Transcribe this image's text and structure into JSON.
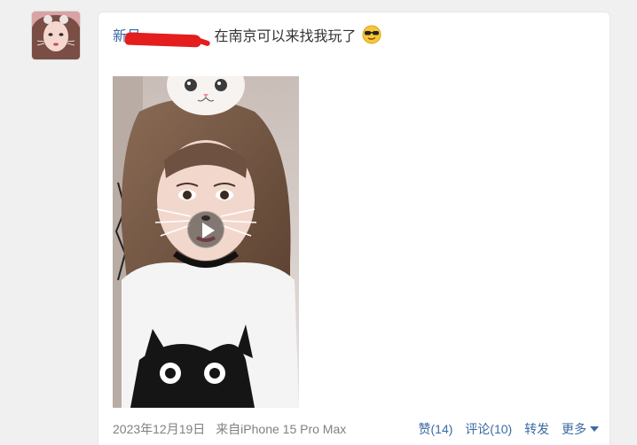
{
  "post": {
    "username": "新号",
    "text": "在南京可以来找我玩了",
    "emoji_icon": "sunglasses-emoji-icon"
  },
  "media": {
    "type": "video",
    "play_icon": "play-icon"
  },
  "footer": {
    "date": "2023年12月19日",
    "source": "来自iPhone 15 Pro Max",
    "like_label": "赞(14)",
    "comment_label": "评论(10)",
    "repost_label": "转发",
    "more_label": "更多"
  },
  "colors": {
    "link": "#3b6aa3",
    "meta": "#808080",
    "redaction": "#e41d1d",
    "background": "#f0f0f0"
  }
}
